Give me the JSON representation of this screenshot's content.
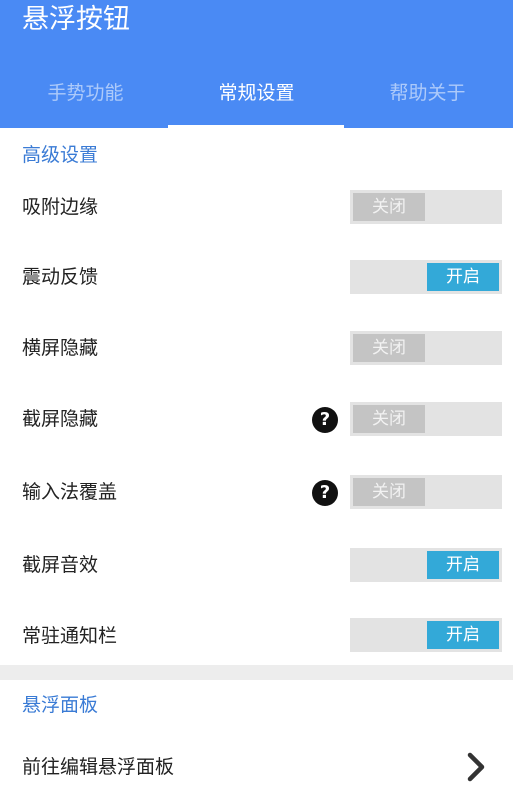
{
  "app": {
    "title": "悬浮按钮"
  },
  "tabs": [
    {
      "label": "手势功能",
      "active": false
    },
    {
      "label": "常规设置",
      "active": true
    },
    {
      "label": "帮助关于",
      "active": false
    }
  ],
  "advanced": {
    "header": "高级设置",
    "rows": [
      {
        "label": "吸附边缘",
        "state": "关闭",
        "on": false
      },
      {
        "label": "震动反馈",
        "state": "开启",
        "on": true
      },
      {
        "label": "横屏隐藏",
        "state": "关闭",
        "on": false
      },
      {
        "label": "截屏隐藏",
        "state": "关闭",
        "on": false,
        "help": "?"
      },
      {
        "label": "输入法覆盖",
        "state": "关闭",
        "on": false,
        "help": "?"
      },
      {
        "label": "截屏音效",
        "state": "开启",
        "on": true
      },
      {
        "label": "常驻通知栏",
        "state": "开启",
        "on": true
      }
    ]
  },
  "panel": {
    "header": "悬浮面板",
    "edit_label": "前往编辑悬浮面板"
  },
  "colors": {
    "appbar": "#4a8af4",
    "switch_on": "#33a9d8",
    "switch_off": "#c4c4c4",
    "section_header": "#3a7bd5"
  }
}
